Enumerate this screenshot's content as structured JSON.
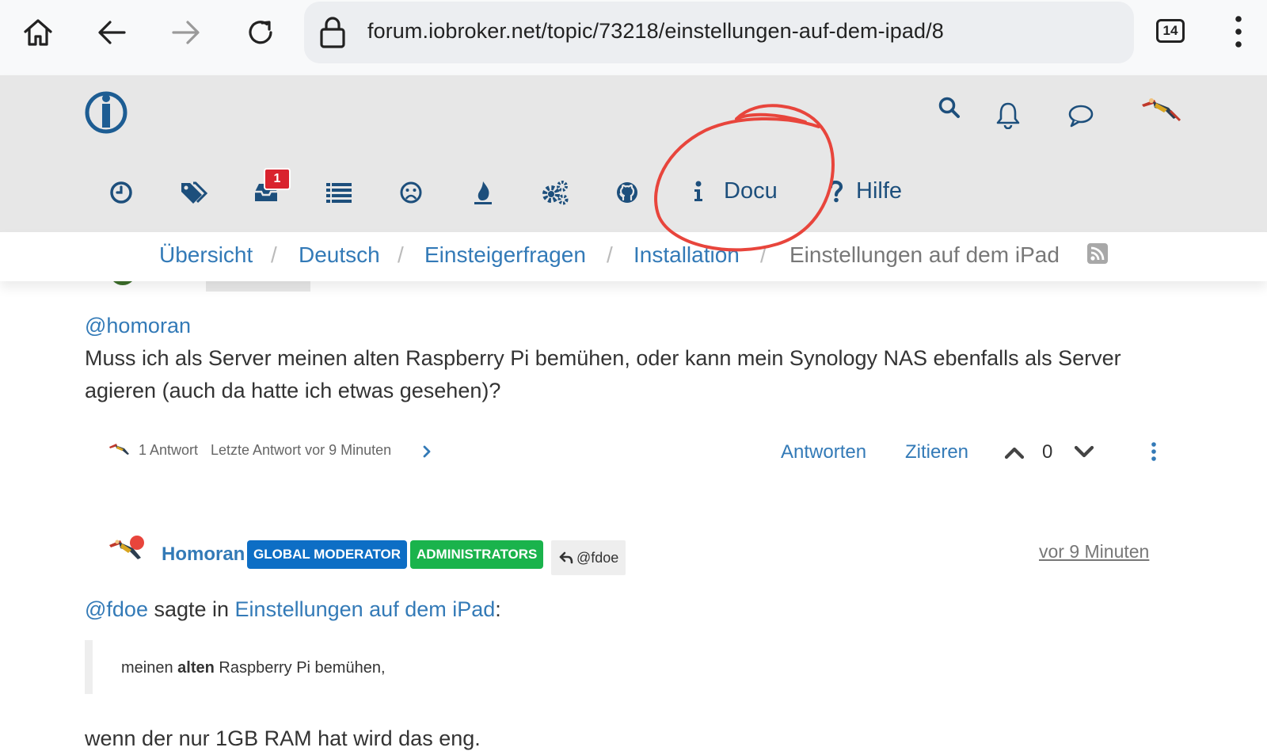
{
  "browser": {
    "url": "forum.iobroker.net/topic/73218/einstellungen-auf-dem-ipad/8",
    "tab_count": "14"
  },
  "nav": {
    "unread_count": "1",
    "docu_label": "Docu",
    "help_label": "Hilfe"
  },
  "breadcrumb": {
    "items": [
      "Übersicht",
      "Deutsch",
      "Einsteigerfragen",
      "Installation"
    ],
    "separator": "/",
    "current": "Einstellungen auf dem iPad"
  },
  "post1": {
    "mention": "@homoran",
    "body": "Muss ich als Server meinen alten Raspberry Pi bemühen, oder kann mein Synology NAS ebenfalls als Server agieren (auch da hatte ich etwas gesehen)?",
    "replies_link": "1 Antwort",
    "last_reply": "Letzte Antwort vor 9 Minuten",
    "reply_label": "Antworten",
    "quote_label": "Zitieren",
    "votes": "0"
  },
  "post2": {
    "author": "Homoran",
    "badges": [
      {
        "label": "GLOBAL MODERATOR",
        "color": "#0d6ec5"
      },
      {
        "label": "ADMINISTRATORS",
        "color": "#1ab34c"
      }
    ],
    "reply_to": "@fdoe",
    "timestamp": "vor 9 Minuten",
    "quote_user": "@fdoe",
    "quote_said": " sagte in ",
    "quote_topic": "Einstellungen auf dem iPad",
    "quote_colon": ":",
    "quote_pre": "meinen ",
    "quote_bold": "alten",
    "quote_post": " Raspberry Pi bemühen,",
    "body": "wenn der nur 1GB RAM hat wird das eng."
  },
  "colors": {
    "link": "#337ab7",
    "nav": "#1d4f7c",
    "annotation_circle": "#e8453c",
    "online_dot": "#e8453c"
  }
}
